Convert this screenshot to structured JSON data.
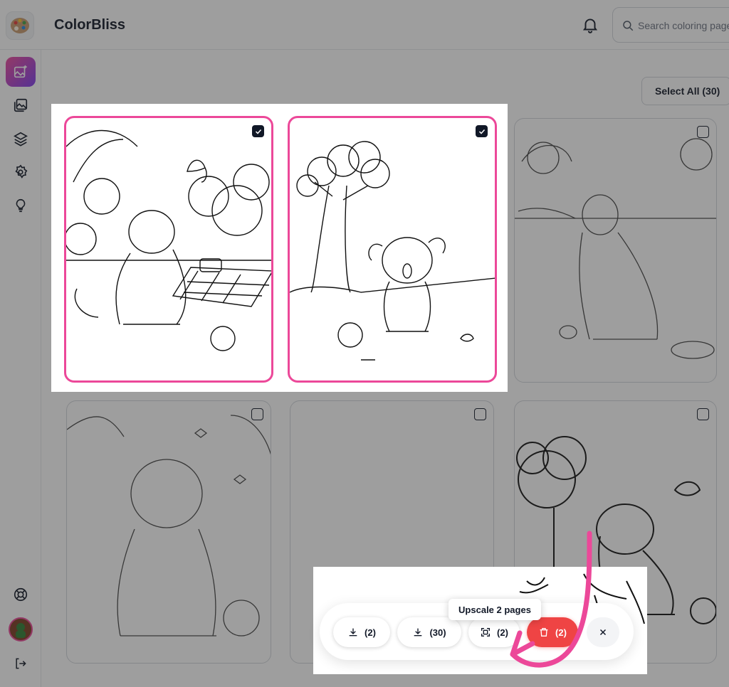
{
  "app": {
    "name": "ColorBliss"
  },
  "header": {
    "search_placeholder": "Search coloring pages"
  },
  "sidebar": {
    "items": [
      {
        "icon": "image-sparkle-icon",
        "active": true
      },
      {
        "icon": "gallery-icon"
      },
      {
        "icon": "layers-icon"
      },
      {
        "icon": "gear-icon"
      },
      {
        "icon": "lightbulb-icon"
      },
      {
        "icon": "lifebuoy-icon"
      },
      {
        "icon": "avatar"
      },
      {
        "icon": "logout-icon"
      }
    ]
  },
  "main": {
    "select_all_label": "Select All (30)"
  },
  "grid": {
    "pages": [
      {
        "subject": "dog on picnic blanket",
        "selected": true
      },
      {
        "subject": "puppy under tree",
        "selected": true
      },
      {
        "subject": "dog in park",
        "selected": false
      },
      {
        "subject": "dog with ball",
        "selected": false
      },
      {
        "subject": "blank page",
        "selected": false
      },
      {
        "subject": "puppy with tree and butterfly",
        "selected": false
      }
    ]
  },
  "toolbar": {
    "download_selected_label": "(2)",
    "download_all_label": "(30)",
    "upscale_label": "(2)",
    "delete_label": "(2)",
    "tooltip": "Upscale 2 pages"
  },
  "colors": {
    "accent": "#ec4899",
    "danger": "#ef4444",
    "arrow": "#ec4899"
  }
}
